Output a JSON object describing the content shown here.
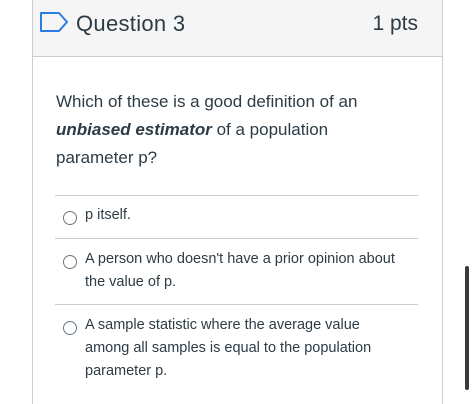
{
  "question": {
    "title": "Question 3",
    "points": "1 pts",
    "text_before": "Which of these is a good definition of an ",
    "text_emphasis": "unbiased estimator",
    "text_after": " of a population parameter p?"
  },
  "answers": [
    {
      "label": "p itself.",
      "selected": false
    },
    {
      "label": "A person who doesn't have a prior opinion about the value of p.",
      "selected": false
    },
    {
      "label": "A sample statistic where the average value among all samples is equal to the population parameter p.",
      "selected": false
    }
  ],
  "icons": {
    "flag": "flag-icon"
  },
  "colors": {
    "text": "#2d3b45",
    "accent_flag": "#2d7be5",
    "border": "#c7cdd1",
    "header_bg": "#f5f5f5"
  }
}
